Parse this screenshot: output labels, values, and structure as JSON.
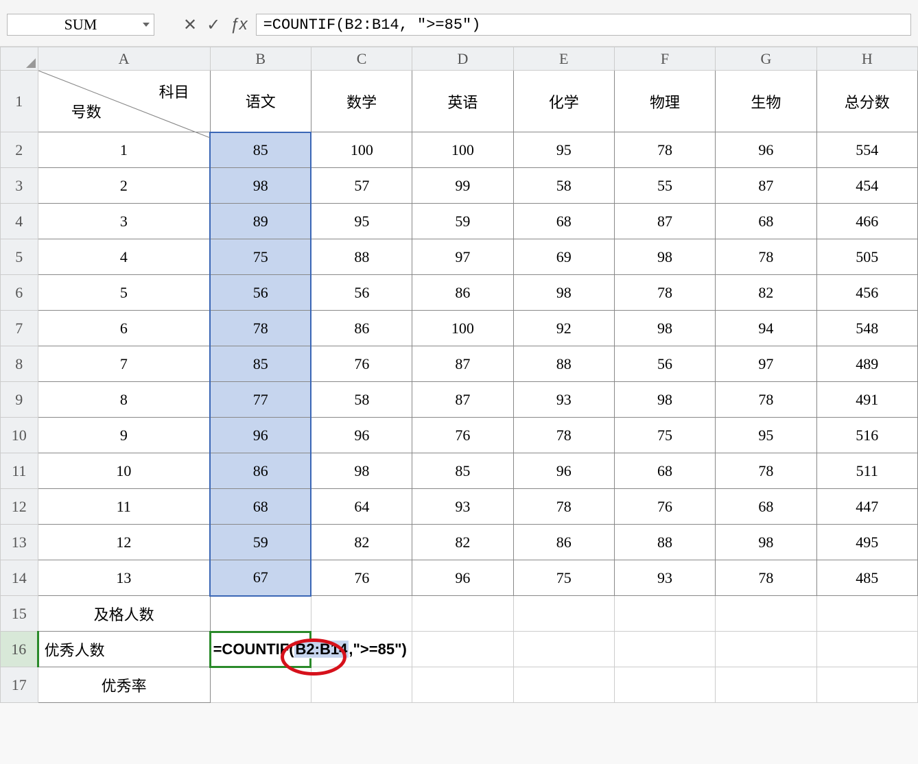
{
  "name_box": "SUM",
  "formula_bar": "=COUNTIF(B2:B14, \">=85\")",
  "col_letters": [
    "A",
    "B",
    "C",
    "D",
    "E",
    "F",
    "G",
    "H"
  ],
  "row_numbers": [
    "1",
    "2",
    "3",
    "4",
    "5",
    "6",
    "7",
    "8",
    "9",
    "10",
    "11",
    "12",
    "13",
    "14",
    "15",
    "16",
    "17"
  ],
  "header_diag": {
    "top": "科目",
    "bottom": "号数"
  },
  "subjects": {
    "B": "语文",
    "C": "数学",
    "D": "英语",
    "E": "化学",
    "F": "物理",
    "G": "生物",
    "H": "总分数"
  },
  "rows": [
    {
      "n": "1",
      "B": "85",
      "C": "100",
      "D": "100",
      "E": "95",
      "F": "78",
      "G": "96",
      "H": "554"
    },
    {
      "n": "2",
      "B": "98",
      "C": "57",
      "D": "99",
      "E": "58",
      "F": "55",
      "G": "87",
      "H": "454"
    },
    {
      "n": "3",
      "B": "89",
      "C": "95",
      "D": "59",
      "E": "68",
      "F": "87",
      "G": "68",
      "H": "466"
    },
    {
      "n": "4",
      "B": "75",
      "C": "88",
      "D": "97",
      "E": "69",
      "F": "98",
      "G": "78",
      "H": "505"
    },
    {
      "n": "5",
      "B": "56",
      "C": "56",
      "D": "86",
      "E": "98",
      "F": "78",
      "G": "82",
      "H": "456"
    },
    {
      "n": "6",
      "B": "78",
      "C": "86",
      "D": "100",
      "E": "92",
      "F": "98",
      "G": "94",
      "H": "548"
    },
    {
      "n": "7",
      "B": "85",
      "C": "76",
      "D": "87",
      "E": "88",
      "F": "56",
      "G": "97",
      "H": "489"
    },
    {
      "n": "8",
      "B": "77",
      "C": "58",
      "D": "87",
      "E": "93",
      "F": "98",
      "G": "78",
      "H": "491"
    },
    {
      "n": "9",
      "B": "96",
      "C": "96",
      "D": "76",
      "E": "78",
      "F": "75",
      "G": "95",
      "H": "516"
    },
    {
      "n": "10",
      "B": "86",
      "C": "98",
      "D": "85",
      "E": "96",
      "F": "68",
      "G": "78",
      "H": "511"
    },
    {
      "n": "11",
      "B": "68",
      "C": "64",
      "D": "93",
      "E": "78",
      "F": "76",
      "G": "68",
      "H": "447"
    },
    {
      "n": "12",
      "B": "59",
      "C": "82",
      "D": "82",
      "E": "86",
      "F": "88",
      "G": "98",
      "H": "495"
    },
    {
      "n": "13",
      "B": "67",
      "C": "76",
      "D": "96",
      "E": "75",
      "F": "93",
      "G": "78",
      "H": "485"
    }
  ],
  "summary_labels": {
    "r15": "及格人数",
    "r16": "优秀人数",
    "r17": "优秀率"
  },
  "editing_cell": {
    "prefix": "=COUNTIF(",
    "range": "B2:B14",
    "mid": ",",
    "criteria": "\">=85\"",
    "suffix": ")"
  }
}
